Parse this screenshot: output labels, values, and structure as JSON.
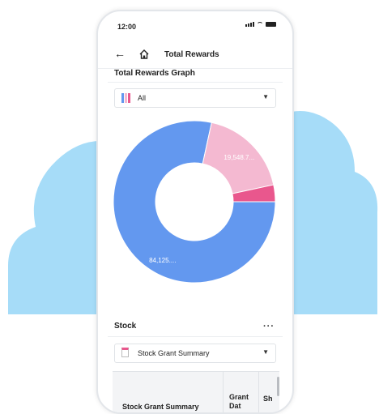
{
  "status_bar": {
    "time": "12:00"
  },
  "app_bar": {
    "title": "Total Rewards",
    "back_icon": "arrow-left-icon",
    "home_icon": "home-icon"
  },
  "graph_section": {
    "title": "Total Rewards Graph",
    "filter": {
      "selected": "All"
    }
  },
  "chart_data": {
    "type": "pie",
    "donut": true,
    "segments": [
      {
        "label": "84,125....",
        "value": 84125,
        "color": "#6398ef"
      },
      {
        "label": "19,548.7...",
        "value": 19548.7,
        "color": "#f4b9d1"
      },
      {
        "label": "",
        "value": 3600,
        "color": "#e9578d"
      }
    ]
  },
  "stock_section": {
    "title": "Stock",
    "more": "···",
    "filter": {
      "selected": "Stock Grant Summary"
    },
    "table": {
      "columns": [
        "Stock Grant Summary",
        "Grant Dat",
        "Sh"
      ]
    }
  },
  "colors": {
    "cloud": "#a6dcf8",
    "accent_pink": "#e9578d",
    "blue": "#6398ef"
  }
}
